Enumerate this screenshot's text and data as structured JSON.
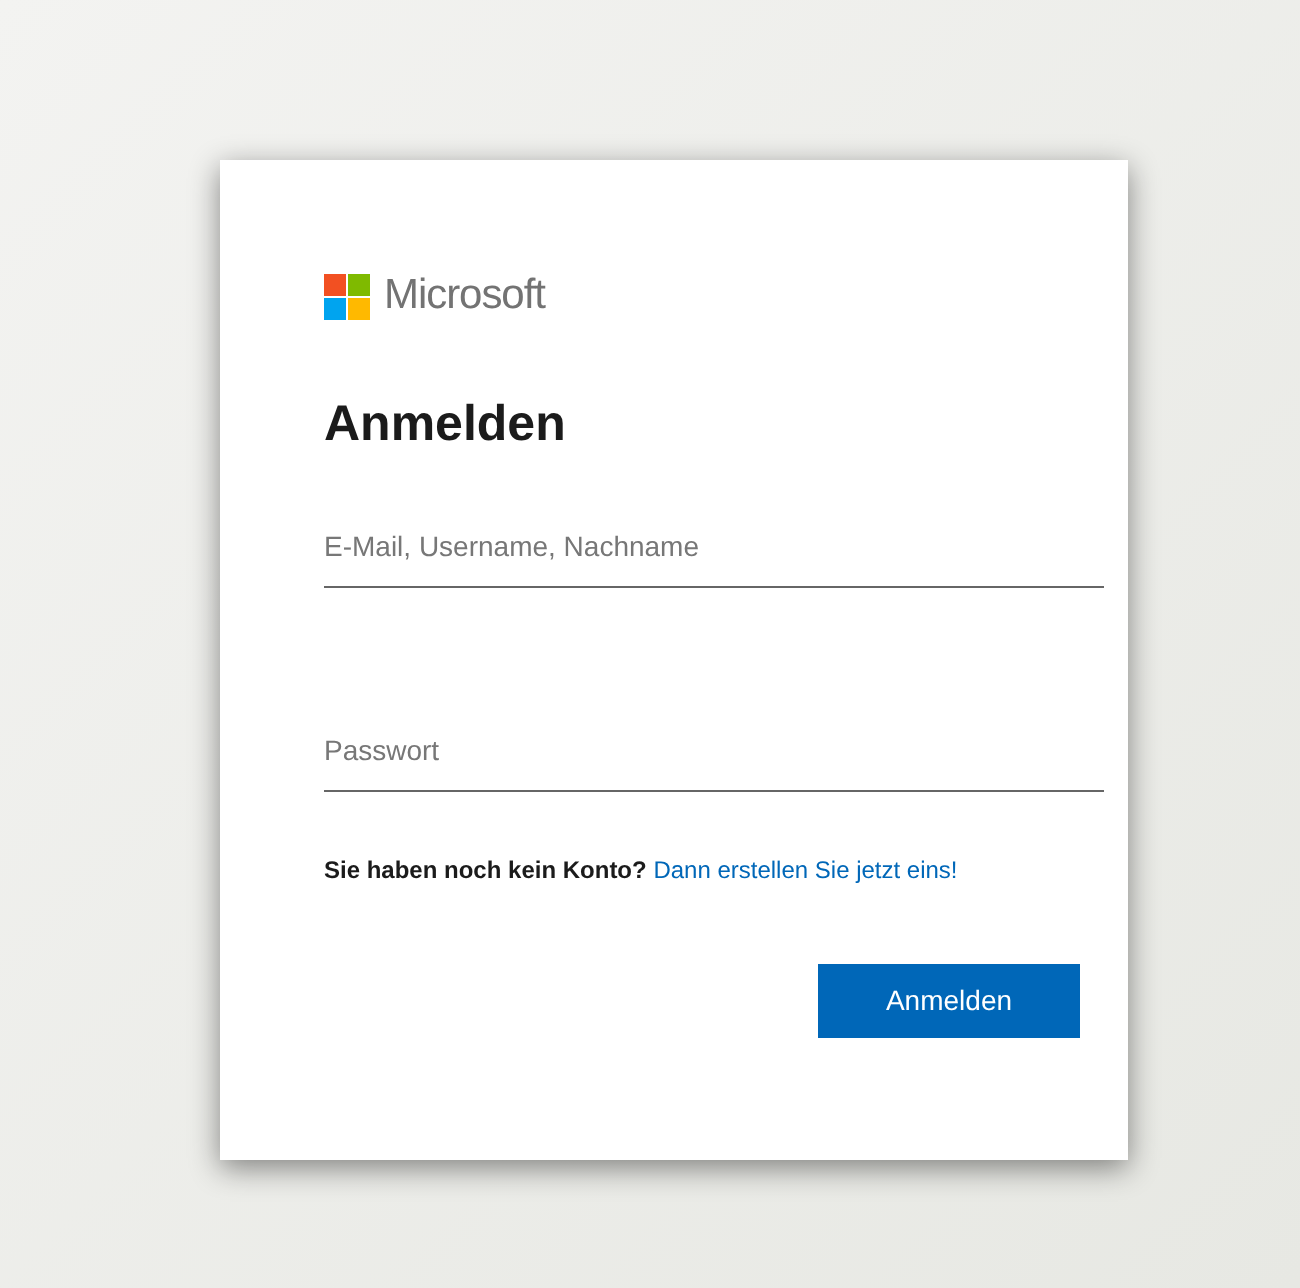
{
  "logo": {
    "text": "Microsoft"
  },
  "title": "Anmelden",
  "fields": [
    {
      "placeholder": "E-Mail, Username, Nachname"
    },
    {
      "placeholder": "Passwort"
    }
  ],
  "signup": {
    "text": "Sie haben noch kein Konto?",
    "link": "Dann erstellen Sie jetzt eins!"
  },
  "button": "Anmelden"
}
